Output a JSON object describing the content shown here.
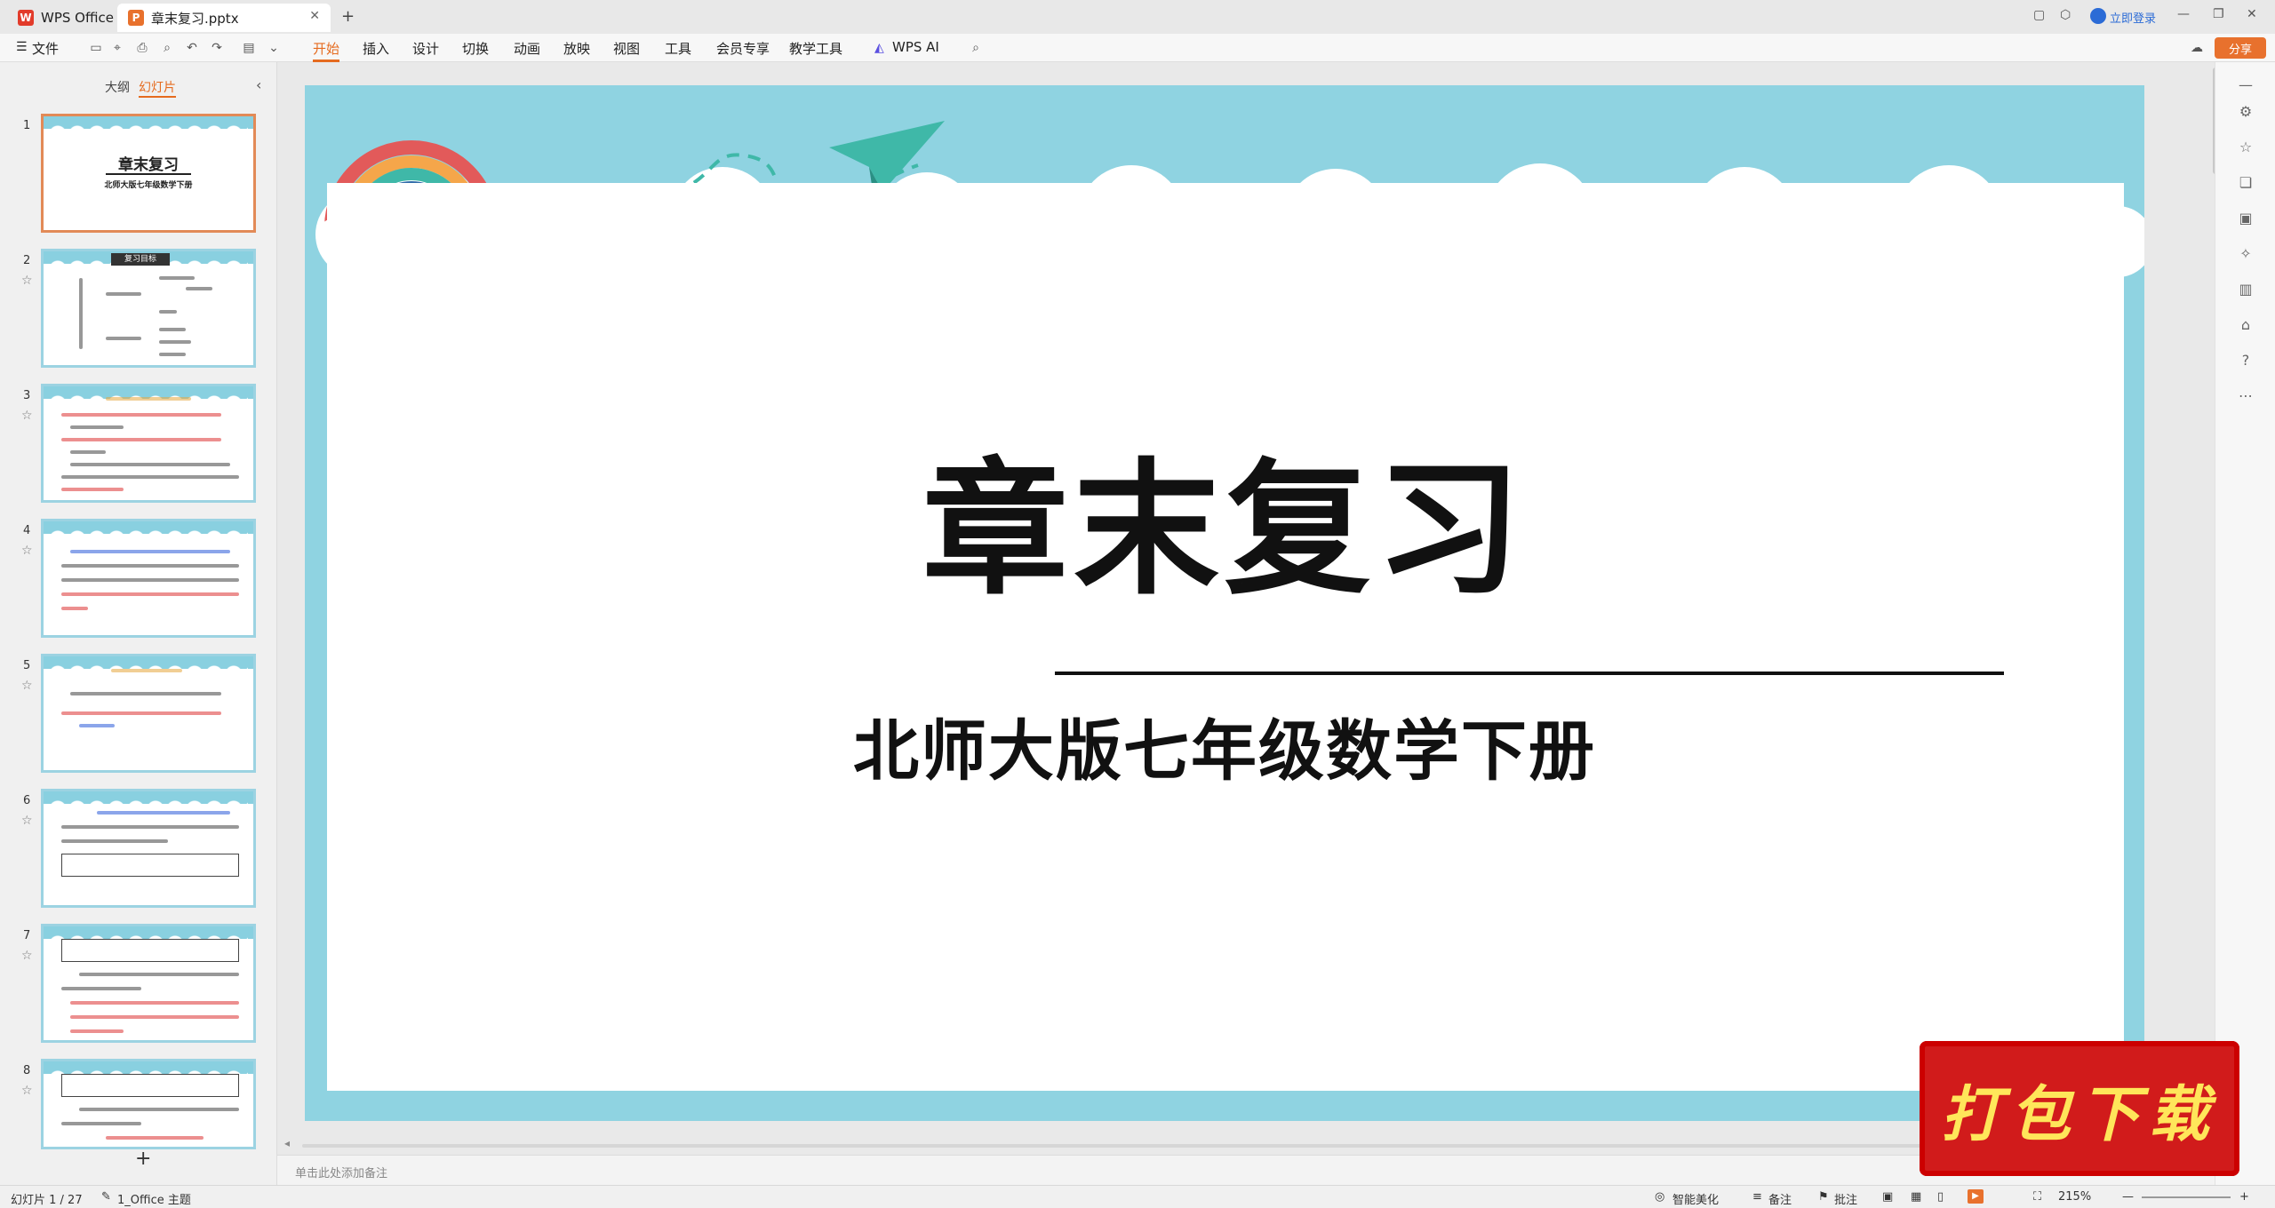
{
  "tabs": [
    {
      "label": "WPS Office"
    },
    {
      "label": "章末复习.pptx"
    }
  ],
  "titlebar": {
    "login_label": "立即登录",
    "share_label": "分享"
  },
  "menu": {
    "file": "文件",
    "items": [
      "开始",
      "插入",
      "设计",
      "切换",
      "动画",
      "放映",
      "视图",
      "工具",
      "会员专享",
      "教学工具",
      "WPS AI"
    ]
  },
  "leftpanel": {
    "tab_outline": "大纲",
    "tab_slides": "幻灯片",
    "slide_numbers": [
      "1",
      "2",
      "3",
      "4",
      "5",
      "6",
      "7",
      "8"
    ],
    "thumb1_title": "章末复习",
    "thumb1_sub": "北师大版七年级数学下册",
    "thumb2_heading": "复习目标",
    "add_label": "+"
  },
  "slide": {
    "title": "章末复习",
    "subtitle": "北师大版七年级数学下册"
  },
  "notes_placeholder": "单击此处添加备注",
  "status": {
    "slide_counter": "幻灯片 1 / 27",
    "theme": "1_Office 主题",
    "smart": "智能美化",
    "notes": "备注",
    "comment": "批注",
    "zoom": "215%"
  },
  "badge": {
    "label": "打包下载"
  },
  "colors": {
    "accent": "#e56b1f",
    "sky": "#8fd3e1",
    "badge": "#d11b1b"
  }
}
